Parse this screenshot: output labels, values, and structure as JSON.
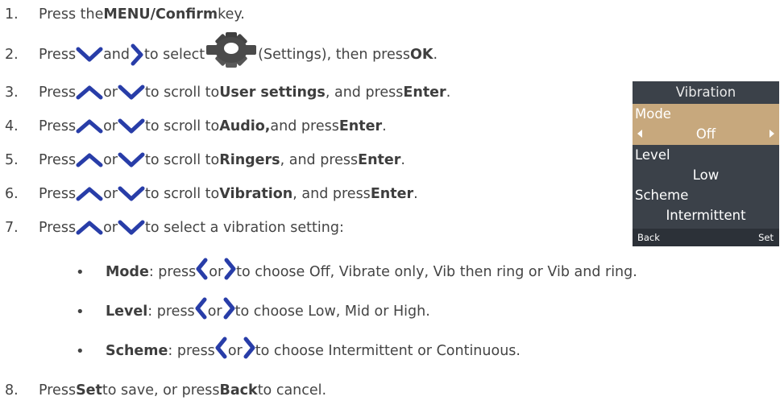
{
  "colors": {
    "text": "#444444",
    "icon": "#283da8",
    "panel_bg": "#3b4149",
    "panel_highlight": "#c7a87d"
  },
  "steps": [
    {
      "num": "1.",
      "t1": "Press the ",
      "b1": "MENU/Confirm",
      "t2": " key."
    },
    {
      "num": "2.",
      "t1": "Press ",
      "t2": " and ",
      "t3": " to select ",
      "t4": " (Settings), then press ",
      "b1": "OK",
      "t5": ".",
      "icon": "gear-icon"
    },
    {
      "num": "3.",
      "t1": "Press ",
      "or": " or ",
      "t2": " to scroll to ",
      "b1": "User settings",
      "t3": ", and press ",
      "b2": "Enter",
      "t4": "."
    },
    {
      "num": "4.",
      "t1": "Press ",
      "or": " or ",
      "t2": " to scroll to ",
      "b1": "Audio,",
      "t3": " and press ",
      "b2": "Enter",
      "t4": "."
    },
    {
      "num": "5.",
      "t1": "Press ",
      "or": " or ",
      "t2": " to scroll to ",
      "b1": "Ringers",
      "t3": ", and press ",
      "b2": "Enter",
      "t4": "."
    },
    {
      "num": "6.",
      "t1": "Press ",
      "or": " or ",
      "t2": " to scroll to ",
      "b1": "Vibration",
      "t3": ", and press ",
      "b2": "Enter",
      "t4": "."
    },
    {
      "num": "7.",
      "t1": "Press ",
      "or": " or ",
      "t2": " to select a vibration setting:"
    },
    {
      "num": "8.",
      "t1": "Press ",
      "b1": "Set",
      "t2": " to save, or press ",
      "b2": "Back",
      "t3": " to cancel."
    }
  ],
  "bullets": [
    {
      "bullet": "•",
      "b1": "Mode",
      "t1": " : press ",
      "or": " or ",
      "t2": " to  choose Off, Vibrate only, Vib then ring or Vib and ring."
    },
    {
      "bullet": "•",
      "b1": "Level",
      "t1": " : press ",
      "or": " or ",
      "t2": " to  choose Low, Mid or High."
    },
    {
      "bullet": "•",
      "b1": "Scheme",
      "t1": " : press ",
      "or": " or ",
      "t2": " to  choose Intermittent or Continuous."
    }
  ],
  "screen": {
    "title": "Vibration",
    "mode_label": "Mode",
    "mode_value": "Off",
    "level_label": "Level",
    "level_value": "Low",
    "scheme_label": "Scheme",
    "scheme_value": "Intermittent",
    "back": "Back",
    "set": "Set"
  }
}
